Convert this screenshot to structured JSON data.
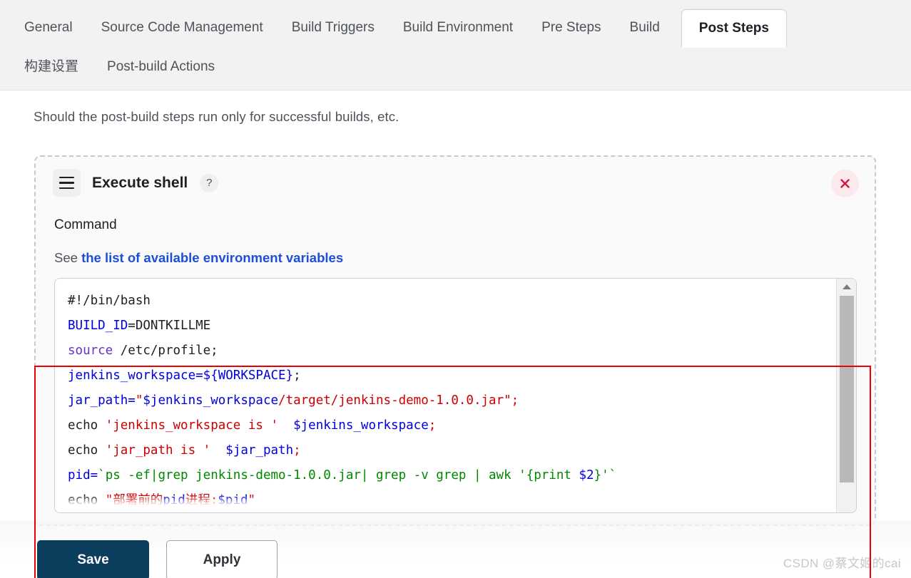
{
  "tabs": {
    "row1": [
      {
        "label": "General",
        "active": false
      },
      {
        "label": "Source Code Management",
        "active": false
      },
      {
        "label": "Build Triggers",
        "active": false
      },
      {
        "label": "Build Environment",
        "active": false
      },
      {
        "label": "Pre Steps",
        "active": false
      },
      {
        "label": "Build",
        "active": false
      },
      {
        "label": "Post Steps",
        "active": true
      }
    ],
    "row2": [
      {
        "label": "构建设置",
        "active": false
      },
      {
        "label": "Post-build Actions",
        "active": false
      }
    ]
  },
  "main": {
    "description": "Should the post-build steps run only for successful builds, etc.",
    "step": {
      "title": "Execute shell",
      "help_glyph": "?",
      "close_glyph": "×",
      "field_label": "Command",
      "see_prefix": "See ",
      "see_link": "the list of available environment variables"
    }
  },
  "code": {
    "lines": [
      [
        {
          "t": "#!/bin/bash",
          "c": "d"
        }
      ],
      [
        {
          "t": "BUILD_ID",
          "c": "b"
        },
        {
          "t": "=DONTKILLME",
          "c": "d"
        }
      ],
      [
        {
          "t": "source",
          "c": "p"
        },
        {
          "t": " /etc/profile;",
          "c": "d"
        }
      ],
      [
        {
          "t": "jenkins_workspace=",
          "c": "b"
        },
        {
          "t": "${WORKSPACE}",
          "c": "b"
        },
        {
          "t": ";",
          "c": "d"
        }
      ],
      [
        {
          "t": "jar_path=",
          "c": "b"
        },
        {
          "t": "\"",
          "c": "r"
        },
        {
          "t": "$jenkins_workspace",
          "c": "b"
        },
        {
          "t": "/target/jenkins-demo-1.0.0.jar\";",
          "c": "r"
        }
      ],
      [
        {
          "t": "echo ",
          "c": "d"
        },
        {
          "t": "'jenkins_workspace is '",
          "c": "r"
        },
        {
          "t": "  ",
          "c": "d"
        },
        {
          "t": "$jenkins_workspace",
          "c": "b"
        },
        {
          "t": ";",
          "c": "r"
        }
      ],
      [
        {
          "t": "echo ",
          "c": "d"
        },
        {
          "t": "'jar_path is '",
          "c": "r"
        },
        {
          "t": "  ",
          "c": "d"
        },
        {
          "t": "$jar_path",
          "c": "b"
        },
        {
          "t": ";",
          "c": "r"
        }
      ],
      [
        {
          "t": "pid=",
          "c": "b"
        },
        {
          "t": "`ps -ef|grep jenkins-demo-1.0.0.jar| grep -v grep | awk '{print ",
          "c": "g"
        },
        {
          "t": "$2",
          "c": "b"
        },
        {
          "t": "}'`",
          "c": "g"
        }
      ],
      [
        {
          "t": "echo ",
          "c": "d"
        },
        {
          "t": "\"部署前的",
          "c": "r"
        },
        {
          "t": "pid",
          "c": "b"
        },
        {
          "t": "进程:",
          "c": "r"
        },
        {
          "t": "$pid",
          "c": "b"
        },
        {
          "t": "\"",
          "c": "r"
        }
      ]
    ]
  },
  "footer": {
    "save_label": "Save",
    "apply_label": "Apply"
  },
  "watermark": "CSDN @蔡文姬的cai",
  "colors": {
    "accent_save": "#0b3d5c",
    "link": "#1d4ed8",
    "annotation_red": "#ee0000",
    "close_red": "#d11a3a",
    "tabbar_bg": "#f2f2f2"
  }
}
